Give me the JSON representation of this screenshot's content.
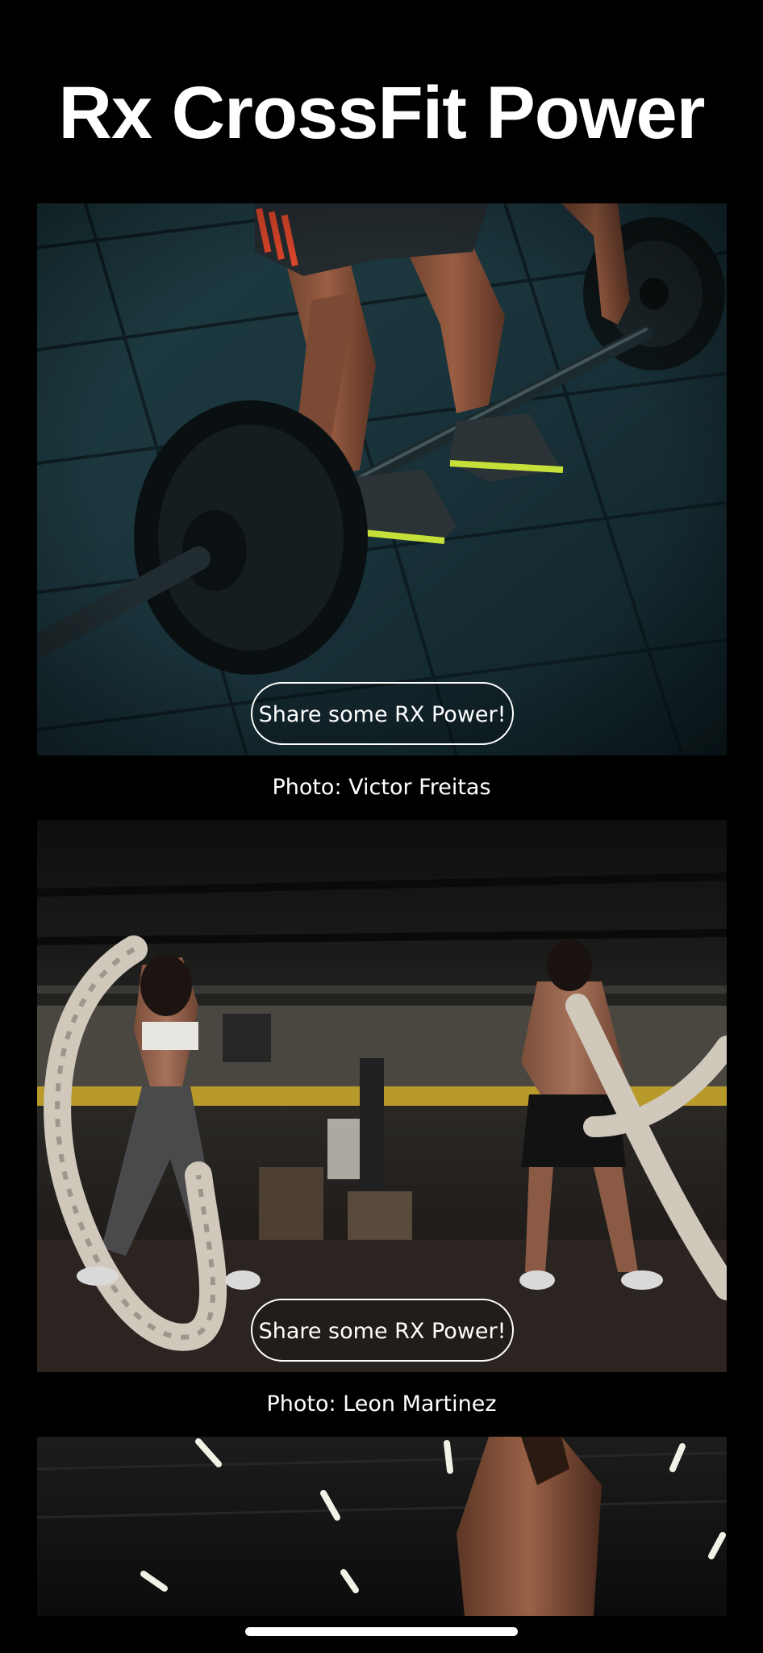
{
  "app": {
    "title": "Rx CrossFit Power"
  },
  "feed": [
    {
      "share_label": "Share some RX Power!",
      "credit": "Photo: Victor Freitas"
    },
    {
      "share_label": "Share some RX Power!",
      "credit": "Photo: Leon Martinez"
    },
    {
      "share_label": "",
      "credit": ""
    }
  ],
  "colors": {
    "background": "#000000",
    "text": "#ffffff",
    "button_border": "#ffffff"
  }
}
